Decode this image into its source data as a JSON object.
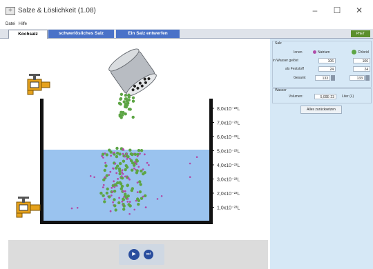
{
  "window": {
    "title": "Salze & Löslichkeit (1.08)",
    "controls": {
      "minimize": "–",
      "maximize": "☐",
      "close": "✕"
    }
  },
  "menu": {
    "items": [
      "Datei",
      "Hilfe"
    ]
  },
  "tabs": [
    {
      "label": "Kochsalz",
      "active": true
    },
    {
      "label": "schwerlösliches Salz",
      "active": false
    },
    {
      "label": "Ein Salz entwerfen",
      "active": false
    }
  ],
  "brand": {
    "logo_text": "PhET"
  },
  "beaker": {
    "volume_ticks": [
      "8,0x10⁻²³L",
      "7,0x10⁻²³L",
      "6,0x10⁻²³L",
      "5,0x10⁻²³L",
      "4,0x10⁻²³L",
      "3,0x10⁻²³L",
      "2,0x10⁻²³L",
      "1,0x10⁻²³L"
    ],
    "water_color": "#9ac3ef"
  },
  "panel": {
    "group_title": "Salz",
    "col_ionen": "Ionen",
    "col_natrium": "Natrium",
    "col_chlorid": "Chlorid",
    "rows": [
      {
        "label": "in Wasser gelöst",
        "natrium": "106",
        "chlorid": "106"
      },
      {
        "label": "als Feststoff",
        "natrium": "24",
        "chlorid": "24"
      },
      {
        "label": "Gesamt",
        "natrium": "133",
        "chlorid": "133"
      }
    ],
    "water_group_title": "Wasser",
    "volume_label": "Volumen:",
    "volume_value": "5,00E-23",
    "volume_unit": "Liter (L)",
    "remove_all_button": "Alles zurücksetzen"
  },
  "playback": {
    "play_icon": "▶",
    "step_icon": "⏭"
  },
  "colors": {
    "sodium": "#b04ca8",
    "chloride": "#5da545",
    "panel_bg": "#d6e8f6",
    "tab_blue": "#4a72c8"
  }
}
